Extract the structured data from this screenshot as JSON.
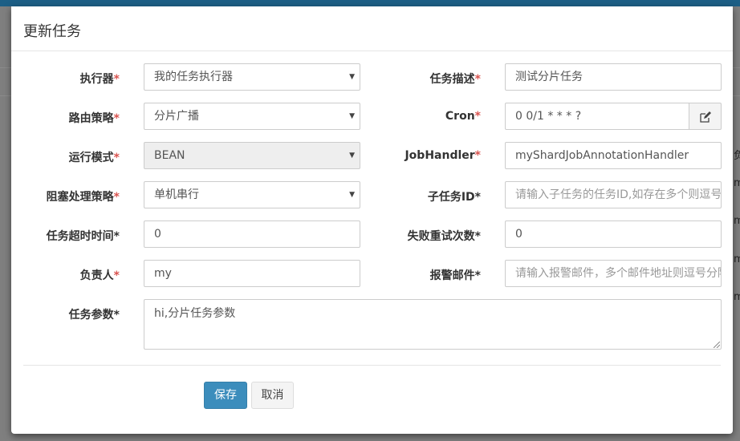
{
  "modal": {
    "title": "更新任务"
  },
  "required_mark": "*",
  "form": {
    "executor": {
      "label": "执行器",
      "required": "*",
      "value": "我的任务执行器"
    },
    "route_strategy": {
      "label": "路由策略",
      "required": "*",
      "value": "分片广播"
    },
    "run_mode": {
      "label": "运行模式",
      "required": "*",
      "value": "BEAN"
    },
    "block_strategy": {
      "label": "阻塞处理策略",
      "required": "*",
      "value": "单机串行"
    },
    "timeout": {
      "label": "任务超时时间*",
      "value": "0"
    },
    "owner": {
      "label": "负责人",
      "required": "*",
      "value": "my"
    },
    "params": {
      "label": "任务参数*",
      "value": "hi,分片任务参数"
    },
    "description": {
      "label": "任务描述",
      "required": "*",
      "value": "测试分片任务"
    },
    "cron": {
      "label": "Cron",
      "required": "*",
      "value": "0 0/1 * * * ?"
    },
    "job_handler": {
      "label": "JobHandler",
      "required": "*",
      "value": "myShardJobAnnotationHandler"
    },
    "child_job_id": {
      "label": "子任务ID*",
      "placeholder": "请输入子任务的任务ID,如存在多个则逗号分隔"
    },
    "retry_count": {
      "label": "失败重试次数*",
      "value": "0"
    },
    "alarm_email": {
      "label": "报警邮件*",
      "placeholder": "请输入报警邮件，多个邮件地址则逗号分隔"
    }
  },
  "buttons": {
    "save": "保存",
    "cancel": "取消"
  },
  "background": {
    "fragments": [
      "负",
      "m",
      "m",
      "m",
      "m"
    ]
  },
  "colors": {
    "primary": "#3c8dbc",
    "required": "#d9534f",
    "topbar": "#1d5f86"
  }
}
